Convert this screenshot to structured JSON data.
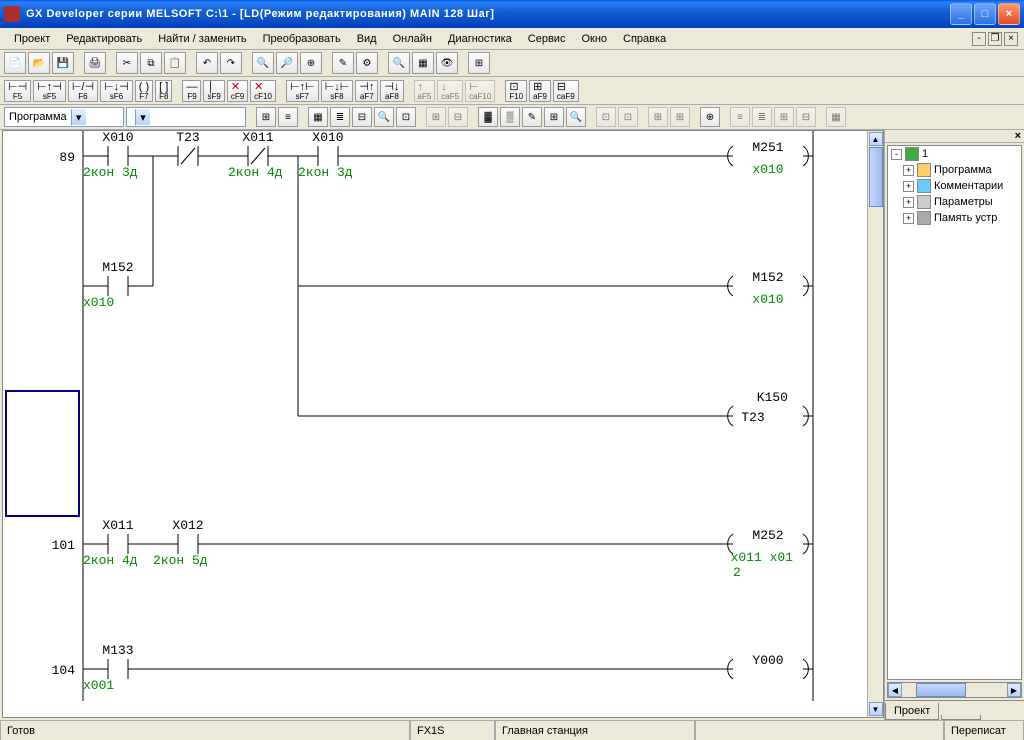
{
  "title": "GX Developer серии MELSOFT C:\\1 - [LD(Режим редактирования)    MAIN    128 Шаг]",
  "menu": [
    "Проект",
    "Редактировать",
    "Найти / заменить",
    "Преобразовать",
    "Вид",
    "Онлайн",
    "Диагностика",
    "Сервис",
    "Окно",
    "Справка"
  ],
  "fnkeys": [
    "F5",
    "sF5",
    "F6",
    "sF6",
    "F7",
    "F8",
    "F9",
    "sF9",
    "cF9",
    "cF10",
    "sF7",
    "sF8",
    "aF7",
    "aF8",
    "aF5",
    "caF5",
    "caF10",
    "F10",
    "aF9",
    "caF9"
  ],
  "dropdown1": "Программа",
  "dropdown2": "",
  "tree": {
    "root": "1",
    "items": [
      "Программа",
      "Комментарии",
      "Параметры",
      "Память устр"
    ]
  },
  "projectTab": "Проект",
  "status": {
    "ready": "Готов",
    "plc": "FX1S",
    "station": "Главная станция",
    "mode": "Переписат"
  },
  "ladder": {
    "rung1": {
      "step": "89",
      "c1": {
        "tag": "X010",
        "note": "2кон 3д"
      },
      "c2": {
        "tag": "T23"
      },
      "c3": {
        "tag": "X011",
        "note": "2кон 4д"
      },
      "c4": {
        "tag": "X010",
        "note": "2кон 3д"
      },
      "out1": {
        "tag": "M251",
        "note": "x010"
      },
      "branch": {
        "tag": "M152",
        "note": "x010"
      },
      "out2": {
        "tag": "M152",
        "note": "x010"
      },
      "out3_k": "K150",
      "out3": {
        "tag": "T23"
      }
    },
    "rung2": {
      "step": "101",
      "c1": {
        "tag": "X011",
        "note": "2кон 4д"
      },
      "c2": {
        "tag": "X012",
        "note": "2кон 5д"
      },
      "out": {
        "tag": "M252",
        "note1": "x011 x01",
        "note2": "2"
      }
    },
    "rung3": {
      "step": "104",
      "c1": {
        "tag": "M133",
        "note": "x001"
      },
      "out": {
        "tag": "Y000"
      }
    }
  }
}
